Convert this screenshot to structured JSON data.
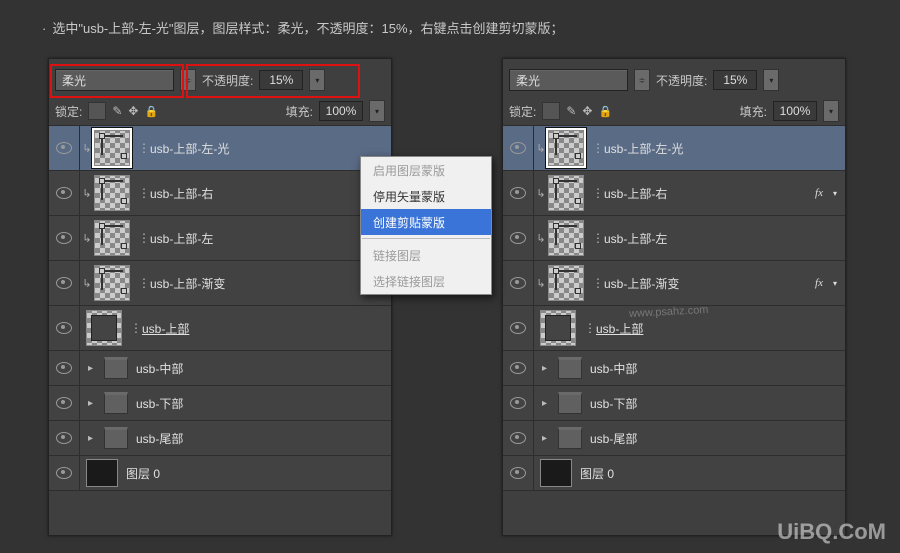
{
  "instruction": "选中\"usb-上部-左-光\"图层，图层样式：柔光，不透明度：15%，右键点击创建剪切蒙版；",
  "controls": {
    "blend_label": "",
    "blend_mode": "柔光",
    "opacity_label": "不透明度:",
    "opacity_value": "15%",
    "lock_label": "锁定:",
    "fill_label": "填充:",
    "fill_value": "100%"
  },
  "layers": [
    {
      "name": "usb-上部-左-光",
      "type": "clip-shape",
      "selected": true
    },
    {
      "name": "usb-上部-右",
      "type": "clip-shape"
    },
    {
      "name": "usb-上部-左",
      "type": "clip-shape"
    },
    {
      "name": "usb-上部-渐变",
      "type": "clip-shape"
    },
    {
      "name": "usb-上部",
      "type": "shape-full",
      "underline": true
    },
    {
      "name": "usb-中部",
      "type": "group"
    },
    {
      "name": "usb-下部",
      "type": "group"
    },
    {
      "name": "usb-尾部",
      "type": "group"
    },
    {
      "name": "图层 0",
      "type": "bg"
    }
  ],
  "right_layers_fx": {
    "1": true,
    "3": true
  },
  "context_menu": {
    "enable_mask": "启用图层蒙版",
    "disable_vmask": "停用矢量蒙版",
    "create_clip": "创建剪贴蒙版",
    "link_layers": "链接图层",
    "select_linked": "选择链接图层"
  },
  "watermark": "UiBQ.CoM",
  "watermark2": "www.psahz.com"
}
